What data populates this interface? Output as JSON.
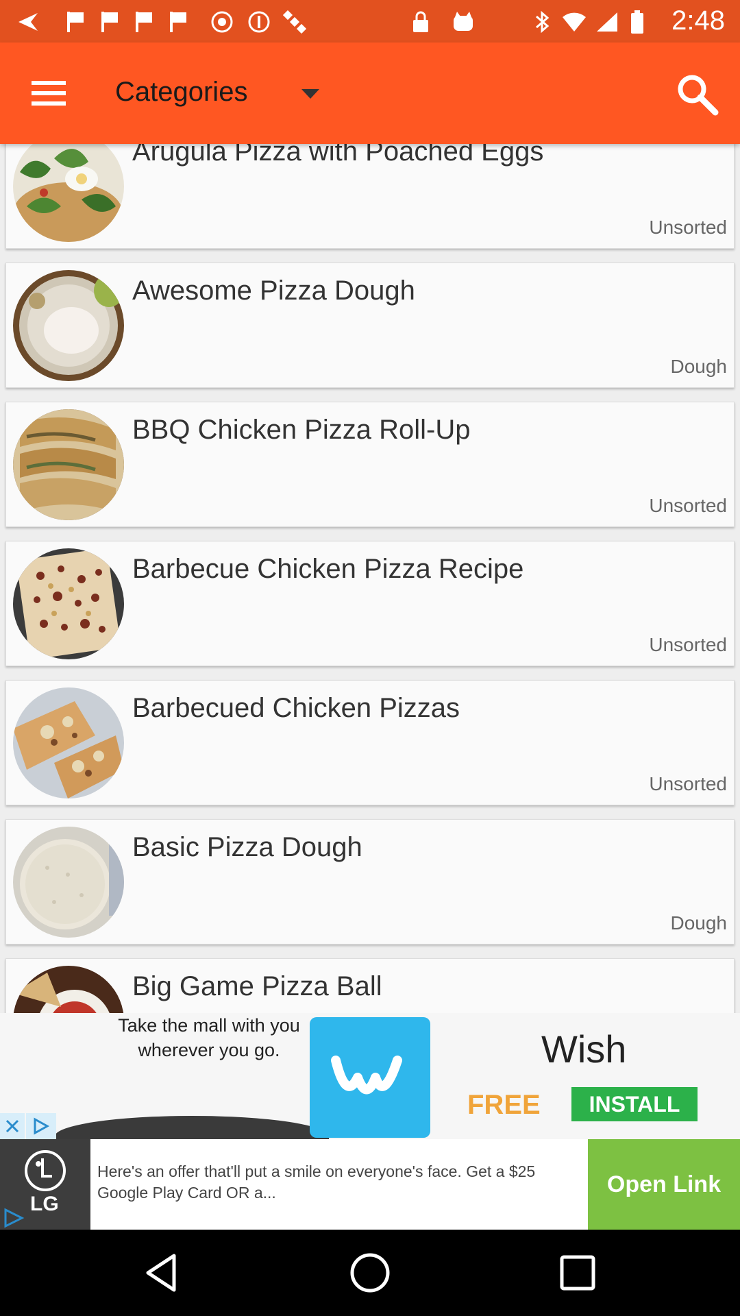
{
  "status_bar": {
    "time": "2:48",
    "icons": [
      "back-arrow-icon",
      "flag-icon",
      "flag-icon",
      "flag-icon",
      "flag-icon",
      "record-icon",
      "do-not-disturb-icon",
      "satellite-icon",
      "lock-icon",
      "cat-icon",
      "bluetooth-icon",
      "wifi-icon",
      "signal-icon",
      "battery-icon"
    ]
  },
  "app_bar": {
    "title": "Categories",
    "menu_icon": "hamburger-menu-icon",
    "search_icon": "search-icon"
  },
  "recipes": [
    {
      "title": "Arugula Pizza with Poached Eggs",
      "category": "Unsorted"
    },
    {
      "title": "Awesome Pizza Dough",
      "category": "Dough"
    },
    {
      "title": "BBQ Chicken Pizza Roll-Up",
      "category": "Unsorted"
    },
    {
      "title": "Barbecue Chicken Pizza Recipe",
      "category": "Unsorted"
    },
    {
      "title": "Barbecued Chicken Pizzas",
      "category": "Unsorted"
    },
    {
      "title": "Basic Pizza Dough",
      "category": "Dough"
    },
    {
      "title": "Big Game Pizza Ball",
      "category": ""
    }
  ],
  "ad_banner": {
    "tagline": "Take the mall with you wherever you go.",
    "brand": "Wish",
    "free": "FREE",
    "install": "INSTALL"
  },
  "ad_banner2": {
    "brand": "LG",
    "text": "Here's an offer that'll put a smile on everyone's face. Get a $25 Google Play Card OR a...",
    "button": "Open Link"
  },
  "colors": {
    "app_bar": "#ff5722",
    "status_bar": "#e2511f",
    "wish_blue": "#2fb7ec",
    "install_green": "#2cb14a",
    "open_link_green": "#7dc142"
  }
}
